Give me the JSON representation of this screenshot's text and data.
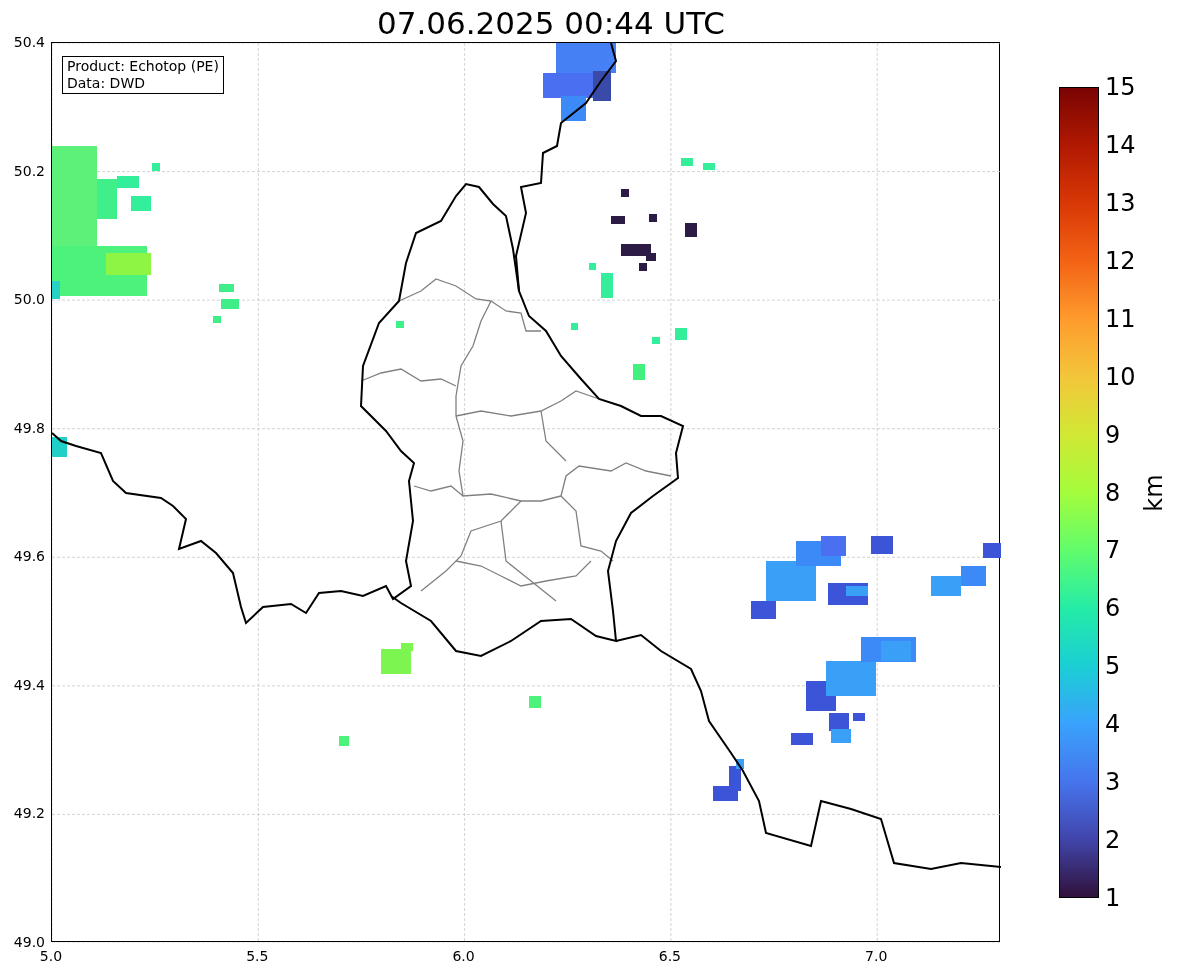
{
  "title": "07.06.2025 00:44 UTC",
  "info_box": [
    "Product: Echotop (PE)",
    "Data: DWD"
  ],
  "y_ticks": [
    "50.4",
    "50.2",
    "50.0",
    "49.8",
    "49.6",
    "49.4",
    "49.2",
    "49.0"
  ],
  "x_ticks": [
    "5.0",
    "5.5",
    "6.0",
    "6.5",
    "7.0"
  ],
  "colorbar": {
    "label": "km",
    "ticks": [
      "15",
      "14",
      "13",
      "12",
      "11",
      "10",
      "9",
      "8",
      "7",
      "6",
      "5",
      "4",
      "3",
      "2",
      "1"
    ]
  }
}
